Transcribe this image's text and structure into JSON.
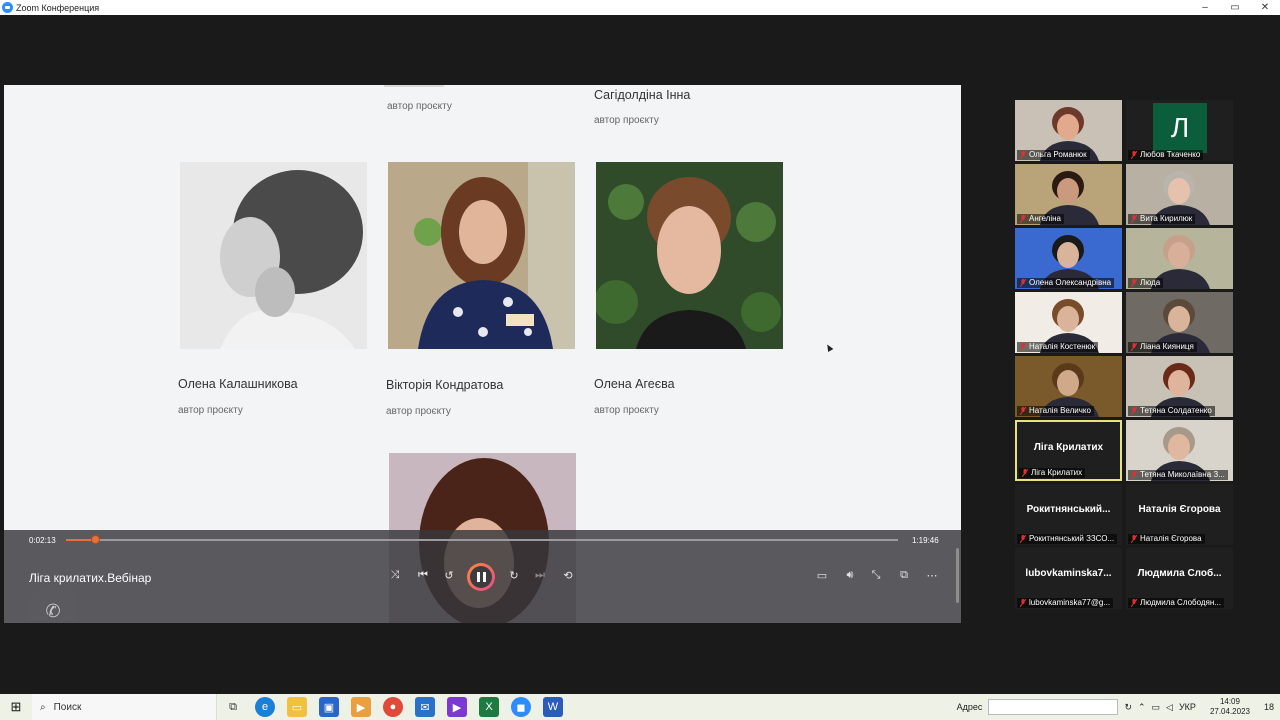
{
  "window": {
    "title": "Zoom Конференция",
    "minimize": "–",
    "restore": "▭",
    "close": "✕"
  },
  "share": {
    "top_people": [
      {
        "name": "Сагідолдіна Інна",
        "role": "автор проєкту"
      }
    ],
    "partial_role": "автор проєкту",
    "people": [
      {
        "name": "Олена Калашникова",
        "role": "автор проєкту"
      },
      {
        "name": "Вікторія Кондратова",
        "role": "автор проєкту"
      },
      {
        "name": "Олена Агеєва",
        "role": "автор проєкту"
      }
    ],
    "player": {
      "current_time": "0:02:13",
      "total_time": "1:19:46",
      "progress_fraction": 0.035,
      "title": "Ліга крилатих.Вебінар"
    }
  },
  "gallery": [
    {
      "name": "Ольга Романюк",
      "type": "video"
    },
    {
      "name": "Любов Ткаченко",
      "type": "avatar",
      "initial": "Л"
    },
    {
      "name": "Ангеліна",
      "type": "video"
    },
    {
      "name": "Вита Кирилюк",
      "type": "video"
    },
    {
      "name": "Олена Олександрівна",
      "type": "video"
    },
    {
      "name": "Люда",
      "type": "video"
    },
    {
      "name": "Наталія Костенюк",
      "type": "video"
    },
    {
      "name": "Ліана Кияниця",
      "type": "video"
    },
    {
      "name": "Наталія Величко",
      "type": "video"
    },
    {
      "name": "Тетяна Солдатенко",
      "type": "video"
    },
    {
      "name": "Ліга Крилатих",
      "type": "name",
      "display": "Ліга Крилатих",
      "active": true
    },
    {
      "name": "Тетяна Миколаївна З...",
      "type": "video"
    },
    {
      "name": "Рокитнянський ЗЗСО...",
      "type": "name",
      "display": "Рокитнянський..."
    },
    {
      "name": "Наталія Єгорова",
      "type": "name",
      "display": "Наталія Єгорова"
    },
    {
      "name": "lubovkaminska77@g...",
      "type": "name",
      "display": "lubovkaminska7..."
    },
    {
      "name": "Людмила Слободян...",
      "type": "name",
      "display": "Людмила  Слоб..."
    }
  ],
  "taskbar": {
    "search_label": "Поиск",
    "address_label": "Адрес",
    "lang": "УКР",
    "time": "14:09",
    "date": "27.04.2023",
    "notifications": "18"
  },
  "colors": {
    "accent": "#e8703a",
    "active_border": "#e7e27a",
    "muted_mic": "#e03131"
  }
}
